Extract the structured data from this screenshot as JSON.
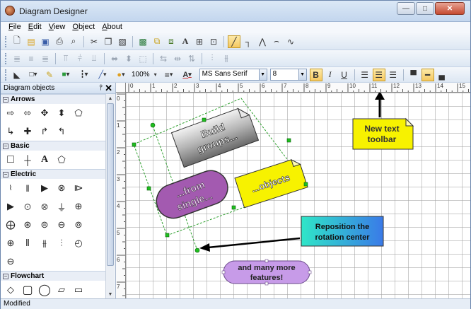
{
  "window": {
    "title": "Diagram Designer"
  },
  "menu": [
    "File",
    "Edit",
    "View",
    "Object",
    "About"
  ],
  "toolbar_format": {
    "zoom": "100%",
    "font_name": "MS Sans Serif",
    "font_size": "8"
  },
  "panel": {
    "title": "Diagram objects",
    "categories": [
      "Arrows",
      "Basic",
      "Electric",
      "Flowchart"
    ]
  },
  "ruler_h": [
    "0",
    "1",
    "2",
    "3",
    "4",
    "5",
    "6",
    "7",
    "8",
    "9",
    "10",
    "11",
    "12",
    "13",
    "14",
    "15"
  ],
  "ruler_v": [
    "0",
    "1",
    "2",
    "3",
    "4",
    "5",
    "6",
    "7"
  ],
  "canvas": {
    "build_groups": [
      "Build",
      "groups..."
    ],
    "from_single": [
      "...from",
      "single..."
    ],
    "objects": "...objects",
    "new_text_toolbar": [
      "New text",
      "toolbar"
    ],
    "reposition": [
      "Reposition the",
      "rotation center"
    ],
    "many_more": [
      "and many more",
      "features!"
    ]
  },
  "status": {
    "text": "Modified"
  }
}
